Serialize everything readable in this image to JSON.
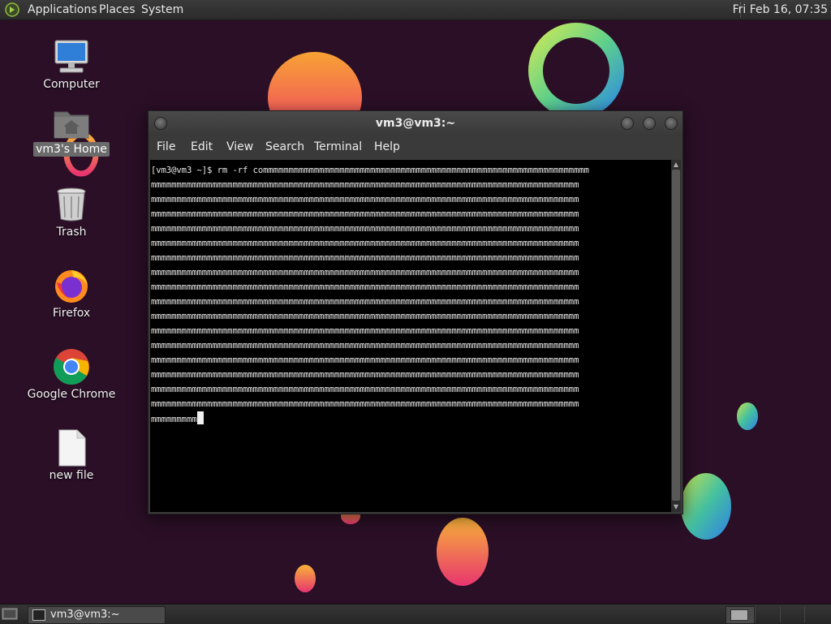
{
  "top_panel": {
    "menus": [
      "Applications",
      "Places",
      "System"
    ],
    "clock": "Fri Feb 16, 07:35"
  },
  "desktop_icons": {
    "computer": "Computer",
    "home": "vm3's Home",
    "trash": "Trash",
    "firefox": "Firefox",
    "chrome": "Google Chrome",
    "new_file": "new file"
  },
  "window": {
    "title": "vm3@vm3:~",
    "menus": [
      "File",
      "Edit",
      "View",
      "Search",
      "Terminal",
      "Help"
    ]
  },
  "terminal": {
    "prompt": "[vm3@vm3 ~]$ ",
    "command_start": "rm -rf commmmmmmmmmmmmmmmmmmmmmmmmmmmmmmmmmmmmmmmmmmmmmmmmmmmmmmmmmmmmmmm",
    "full_lines": [
      "mmmmmmmmmmmmmmmmmmmmmmmmmmmmmmmmmmmmmmmmmmmmmmmmmmmmmmmmmmmmmmmmmmmmmmmmmmmmmmmmmmmm",
      "mmmmmmmmmmmmmmmmmmmmmmmmmmmmmmmmmmmmmmmmmmmmmmmmmmmmmmmmmmmmmmmmmmmmmmmmmmmmmmmmmmmm",
      "mmmmmmmmmmmmmmmmmmmmmmmmmmmmmmmmmmmmmmmmmmmmmmmmmmmmmmmmmmmmmmmmmmmmmmmmmmmmmmmmmmmm",
      "mmmmmmmmmmmmmmmmmmmmmmmmmmmmmmmmmmmmmmmmmmmmmmmmmmmmmmmmmmmmmmmmmmmmmmmmmmmmmmmmmmmm",
      "mmmmmmmmmmmmmmmmmmmmmmmmmmmmmmmmmmmmmmmmmmmmmmmmmmmmmmmmmmmmmmmmmmmmmmmmmmmmmmmmmmmm",
      "mmmmmmmmmmmmmmmmmmmmmmmmmmmmmmmmmmmmmmmmmmmmmmmmmmmmmmmmmmmmmmmmmmmmmmmmmmmmmmmmmmmm",
      "mmmmmmmmmmmmmmmmmmmmmmmmmmmmmmmmmmmmmmmmmmmmmmmmmmmmmmmmmmmmmmmmmmmmmmmmmmmmmmmmmmmm",
      "mmmmmmmmmmmmmmmmmmmmmmmmmmmmmmmmmmmmmmmmmmmmmmmmmmmmmmmmmmmmmmmmmmmmmmmmmmmmmmmmmmmm",
      "mmmmmmmmmmmmmmmmmmmmmmmmmmmmmmmmmmmmmmmmmmmmmmmmmmmmmmmmmmmmmmmmmmmmmmmmmmmmmmmmmmmm",
      "mmmmmmmmmmmmmmmmmmmmmmmmmmmmmmmmmmmmmmmmmmmmmmmmmmmmmmmmmmmmmmmmmmmmmmmmmmmmmmmmmmmm",
      "mmmmmmmmmmmmmmmmmmmmmmmmmmmmmmmmmmmmmmmmmmmmmmmmmmmmmmmmmmmmmmmmmmmmmmmmmmmmmmmmmmmm",
      "mmmmmmmmmmmmmmmmmmmmmmmmmmmmmmmmmmmmmmmmmmmmmmmmmmmmmmmmmmmmmmmmmmmmmmmmmmmmmmmmmmmm",
      "mmmmmmmmmmmmmmmmmmmmmmmmmmmmmmmmmmmmmmmmmmmmmmmmmmmmmmmmmmmmmmmmmmmmmmmmmmmmmmmmmmmm",
      "mmmmmmmmmmmmmmmmmmmmmmmmmmmmmmmmmmmmmmmmmmmmmmmmmmmmmmmmmmmmmmmmmmmmmmmmmmmmmmmmmmmm",
      "mmmmmmmmmmmmmmmmmmmmmmmmmmmmmmmmmmmmmmmmmmmmmmmmmmmmmmmmmmmmmmmmmmmmmmmmmmmmmmmmmmmm",
      "mmmmmmmmmmmmmmmmmmmmmmmmmmmmmmmmmmmmmmmmmmmmmmmmmmmmmmmmmmmmmmmmmmmmmmmmmmmmmmmmmmmm"
    ],
    "last_line": "mmmmmmmmm"
  },
  "bottom_panel": {
    "task_label": "vm3@vm3:~"
  },
  "colors": {
    "desktop_bg": "#2a0f26",
    "panel_bg": "#2b2b2b",
    "terminal_bg": "#000000",
    "terminal_fg": "#e8e8e8"
  }
}
